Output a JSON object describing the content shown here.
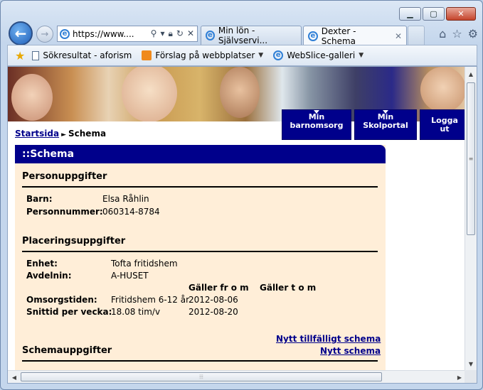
{
  "browser": {
    "address": "https://www....",
    "tabs": [
      {
        "label": "Min lön - Självservi..."
      },
      {
        "label": "Dexter - Schema"
      }
    ],
    "favorites": [
      {
        "label": "Sökresultat - aforism"
      },
      {
        "label": "Förslag på webbplatser"
      },
      {
        "label": "WebSlice-galleri"
      }
    ]
  },
  "header": {
    "nav": [
      {
        "label": "Min barnomsorg"
      },
      {
        "label": "Min Skolportal"
      },
      {
        "label": "Logga ut"
      }
    ]
  },
  "breadcrumb": {
    "home": "Startsida",
    "current": "Schema"
  },
  "panel": {
    "title": "::Schema",
    "person": {
      "title": "Personuppgifter",
      "barn_label": "Barn:",
      "barn_value": "Elsa Råhlin",
      "pnr_label": "Personnummer:",
      "pnr_value": "060314-8784"
    },
    "placering": {
      "title": "Placeringsuppgifter",
      "enhet_label": "Enhet:",
      "enhet_value": "Tofta fritidshem",
      "avd_label": "Avdelnin:",
      "avd_value": "A-HUSET",
      "col_from": "Gäller fr o m",
      "col_to": "Gäller t o m",
      "omsorg_label": "Omsorgstiden:",
      "omsorg_value": "Fritidshem 6-12 år",
      "omsorg_from": "2012-08-06",
      "snitt_label": "Snittid per vecka:",
      "snitt_value": "18.08 tim/v",
      "snitt_from": "2012-08-20"
    },
    "schema": {
      "title": "Schemauppgifter",
      "link_temp": "Nytt tillfälligt schema",
      "link_new": "Nytt schema"
    }
  }
}
